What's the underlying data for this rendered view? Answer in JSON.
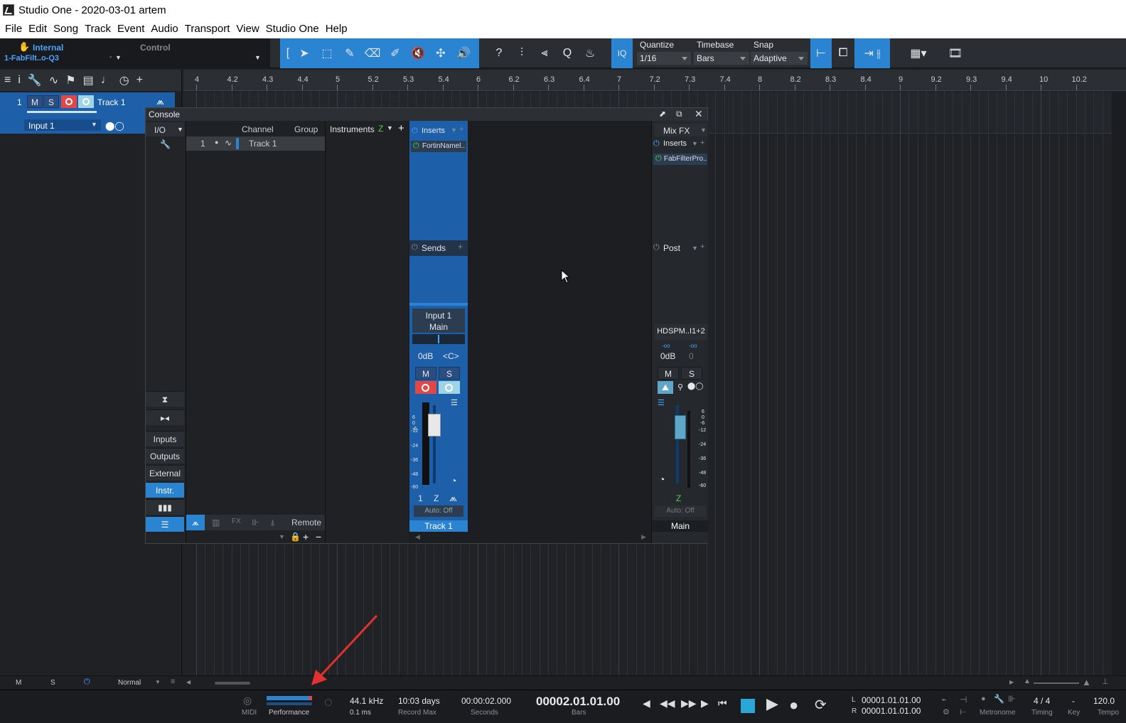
{
  "window": {
    "title": "Studio One - 2020-03-01 artem"
  },
  "menu": [
    "File",
    "Edit",
    "Song",
    "Track",
    "Event",
    "Audio",
    "Transport",
    "View",
    "Studio One",
    "Help"
  ],
  "toolbar": {
    "sync_label": "Internal",
    "sync_sub": "1-FabFilt..o-Q3",
    "sync_sub2": "-",
    "control_label": "Control",
    "iq_label": "IQ",
    "quantize_label": "Quantize",
    "quantize_value": "1/16",
    "timebase_label": "Timebase",
    "timebase_value": "Bars",
    "snap_label": "Snap",
    "snap_value": "Adaptive",
    "help_label": "?"
  },
  "ruler": {
    "ticks": [
      "4",
      "4.2",
      "4.3",
      "4.4",
      "5",
      "5.2",
      "5.3",
      "5.4",
      "6",
      "6.2",
      "6.3",
      "6.4",
      "7",
      "7.2",
      "7.3",
      "7.4",
      "8",
      "8.2",
      "8.3",
      "8.4",
      "9",
      "9.2",
      "9.3",
      "9.4",
      "10",
      "10.2"
    ]
  },
  "track": {
    "number": "1",
    "mute": "M",
    "solo": "S",
    "name": "Track 1",
    "input": "Input 1"
  },
  "console": {
    "title": "Console",
    "io_label": "I/O",
    "channel_header": "Channel",
    "group_header": "Group",
    "channel_row_num": "1",
    "channel_row_name": "Track 1",
    "instruments_label": "Instruments",
    "side_buttons": [
      "Inputs",
      "Outputs",
      "External",
      "Instr."
    ],
    "remote_label": "Remote",
    "fx_label": "FX",
    "strip": {
      "inserts_label": "Inserts",
      "insert_plugin": "FortinNamel..",
      "sends_label": "Sends",
      "input": "Input 1",
      "output": "Main",
      "volume": "0dB",
      "pan": "<C>",
      "mute": "M",
      "solo": "S",
      "channel_num": "1",
      "auto": "Auto: Off",
      "name": "Track 1",
      "scale": [
        "6",
        "0",
        "-6",
        "-12",
        "-24",
        "-36",
        "-48",
        "-60"
      ]
    },
    "main": {
      "mixfx_label": "Mix FX",
      "inserts_label": "Inserts",
      "insert_plugin": "FabFilterPro..",
      "post_label": "Post",
      "device": "HDSPM..I1+2",
      "minus_inf_l": "-oo",
      "minus_inf_r": "-oo",
      "volume": "0dB",
      "pan": "0",
      "mute": "M",
      "solo": "S",
      "auto": "Auto: Off",
      "name": "Main",
      "scale": [
        "6",
        "0",
        "-6",
        "-12",
        "-24",
        "-36",
        "-48",
        "-60"
      ]
    }
  },
  "statusbar": {
    "m": "M",
    "s": "S",
    "mode": "Normal"
  },
  "transport": {
    "midi_label": "MIDI",
    "performance_label": "Performance",
    "sample_rate": "44.1 kHz",
    "latency": "0.1 ms",
    "record_max_value": "10:03 days",
    "record_max_label": "Record Max",
    "seconds_value": "00:00:02.000",
    "seconds_label": "Seconds",
    "bars_value": "00002.01.01.00",
    "bars_label": "Bars",
    "loop_l_label": "L",
    "loop_l_value": "00001.01.01.00",
    "loop_r_label": "R",
    "loop_r_value": "00001.01.01.00",
    "metronome_label": "Metronome",
    "timing_value": "4 / 4",
    "timing_label": "Timing",
    "key_value": "-",
    "key_label": "Key",
    "tempo_value": "120.0",
    "tempo_label": "Tempo"
  },
  "colors": {
    "accent": "#2a84d1",
    "strip": "#1d5fa8",
    "record": "#e04848"
  }
}
